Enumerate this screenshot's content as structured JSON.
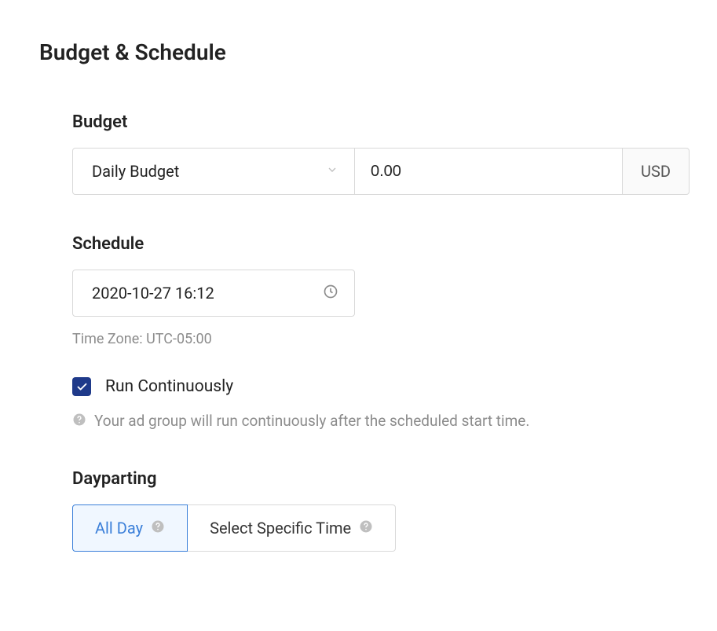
{
  "title": "Budget & Schedule",
  "budget": {
    "label": "Budget",
    "type_selected": "Daily Budget",
    "amount": "0.00",
    "currency": "USD"
  },
  "schedule": {
    "label": "Schedule",
    "datetime": "2020-10-27 16:12",
    "timezone": "Time Zone: UTC-05:00",
    "run_continuously_label": "Run Continuously",
    "run_continuously_checked": true,
    "help_text": "Your ad group will run continuously after the scheduled start time."
  },
  "dayparting": {
    "label": "Dayparting",
    "tabs": {
      "all_day": "All Day",
      "specific": "Select Specific Time"
    }
  }
}
